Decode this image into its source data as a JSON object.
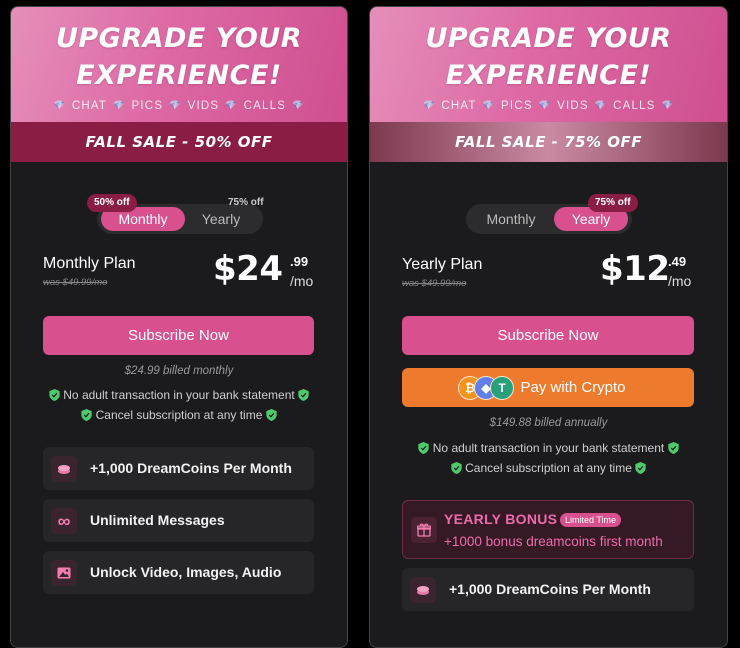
{
  "left": {
    "hero_line1": "UPGRADE YOUR",
    "hero_line2": "EXPERIENCE!",
    "features": [
      "CHAT",
      "PICS",
      "VIDS",
      "CALLS"
    ],
    "sale": "FALL SALE - 50% OFF",
    "toggle": {
      "monthly": "Monthly",
      "yearly": "Yearly",
      "active": "Monthly",
      "monthly_badge": "50% off",
      "yearly_badge": "75% off"
    },
    "plan_name": "Monthly Plan",
    "was": "was $49.99/mo",
    "price": "$24",
    "cents": ".99",
    "per": "/mo",
    "subscribe": "Subscribe Now",
    "billed": "$24.99 billed monthly",
    "benefits": [
      "No adult transaction in your bank statement",
      "Cancel subscription at any time"
    ],
    "feature_items": [
      {
        "icon": "coins-icon",
        "label": "+1,000 DreamCoins Per Month"
      },
      {
        "icon": "infinity-icon",
        "label": "Unlimited Messages"
      },
      {
        "icon": "image-icon",
        "label": "Unlock Video, Images, Audio"
      }
    ]
  },
  "right": {
    "hero_line1": "UPGRADE YOUR",
    "hero_line2": "EXPERIENCE!",
    "features": [
      "CHAT",
      "PICS",
      "VIDS",
      "CALLS"
    ],
    "sale": "FALL SALE - 75% OFF",
    "toggle": {
      "monthly": "Monthly",
      "yearly": "Yearly",
      "active": "Yearly",
      "yearly_badge": "75% off"
    },
    "plan_name": "Yearly Plan",
    "was": "was $49.99/mo",
    "price": "$12",
    "cents": ".49",
    "per": "/mo",
    "subscribe": "Subscribe Now",
    "crypto": "Pay with Crypto",
    "billed": "$149.88 billed annually",
    "benefits": [
      "No adult transaction in your bank statement",
      "Cancel subscription at any time"
    ],
    "bonus": {
      "title": "YEARLY BONUS",
      "tag": "Limited Time",
      "text": "+1000 bonus dreamcoins first month"
    },
    "feature_items": [
      {
        "icon": "coins-icon",
        "label": "+1,000 DreamCoins Per Month"
      }
    ]
  },
  "colors": {
    "accent": "#d9508e",
    "crypto": "#ee7a2e",
    "shield": "#4ec96b",
    "bonus_text": "#ec6ba9"
  }
}
